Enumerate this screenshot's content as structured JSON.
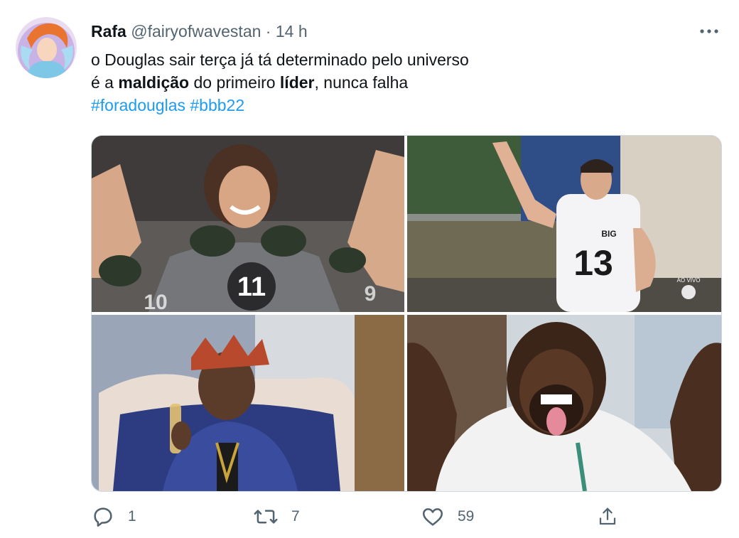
{
  "tweet": {
    "display_name": "Rafa",
    "handle": "@fairyofwavestan",
    "separator": "·",
    "time": "14 h",
    "line1": "o Douglas sair terça já tá determinado pelo universo",
    "line2_part1": "é a ",
    "line2_bold1": "maldição",
    "line2_part2": " do primeiro ",
    "line2_bold2": "líder",
    "line2_part3": ", nunca falha",
    "hashtags": [
      "#foradouglas",
      "#bbb22"
    ],
    "images": [
      {
        "jersey_number": "11",
        "jersey_number_bg": "10",
        "jersey_number_bg2": "9"
      },
      {
        "jersey_number": "13",
        "logo_text": "BIG",
        "badge": "AO VIVO"
      },
      {},
      {}
    ]
  },
  "actions": {
    "reply_count": "1",
    "retweet_count": "7",
    "like_count": "59"
  },
  "icons": {
    "more": "more-options-icon",
    "reply": "reply-icon",
    "retweet": "retweet-icon",
    "like": "like-icon",
    "share": "share-icon"
  },
  "colors": {
    "link": "#1d9bf0",
    "secondary_text": "#536471",
    "primary_text": "#0f1419",
    "border": "#cfd9de"
  }
}
